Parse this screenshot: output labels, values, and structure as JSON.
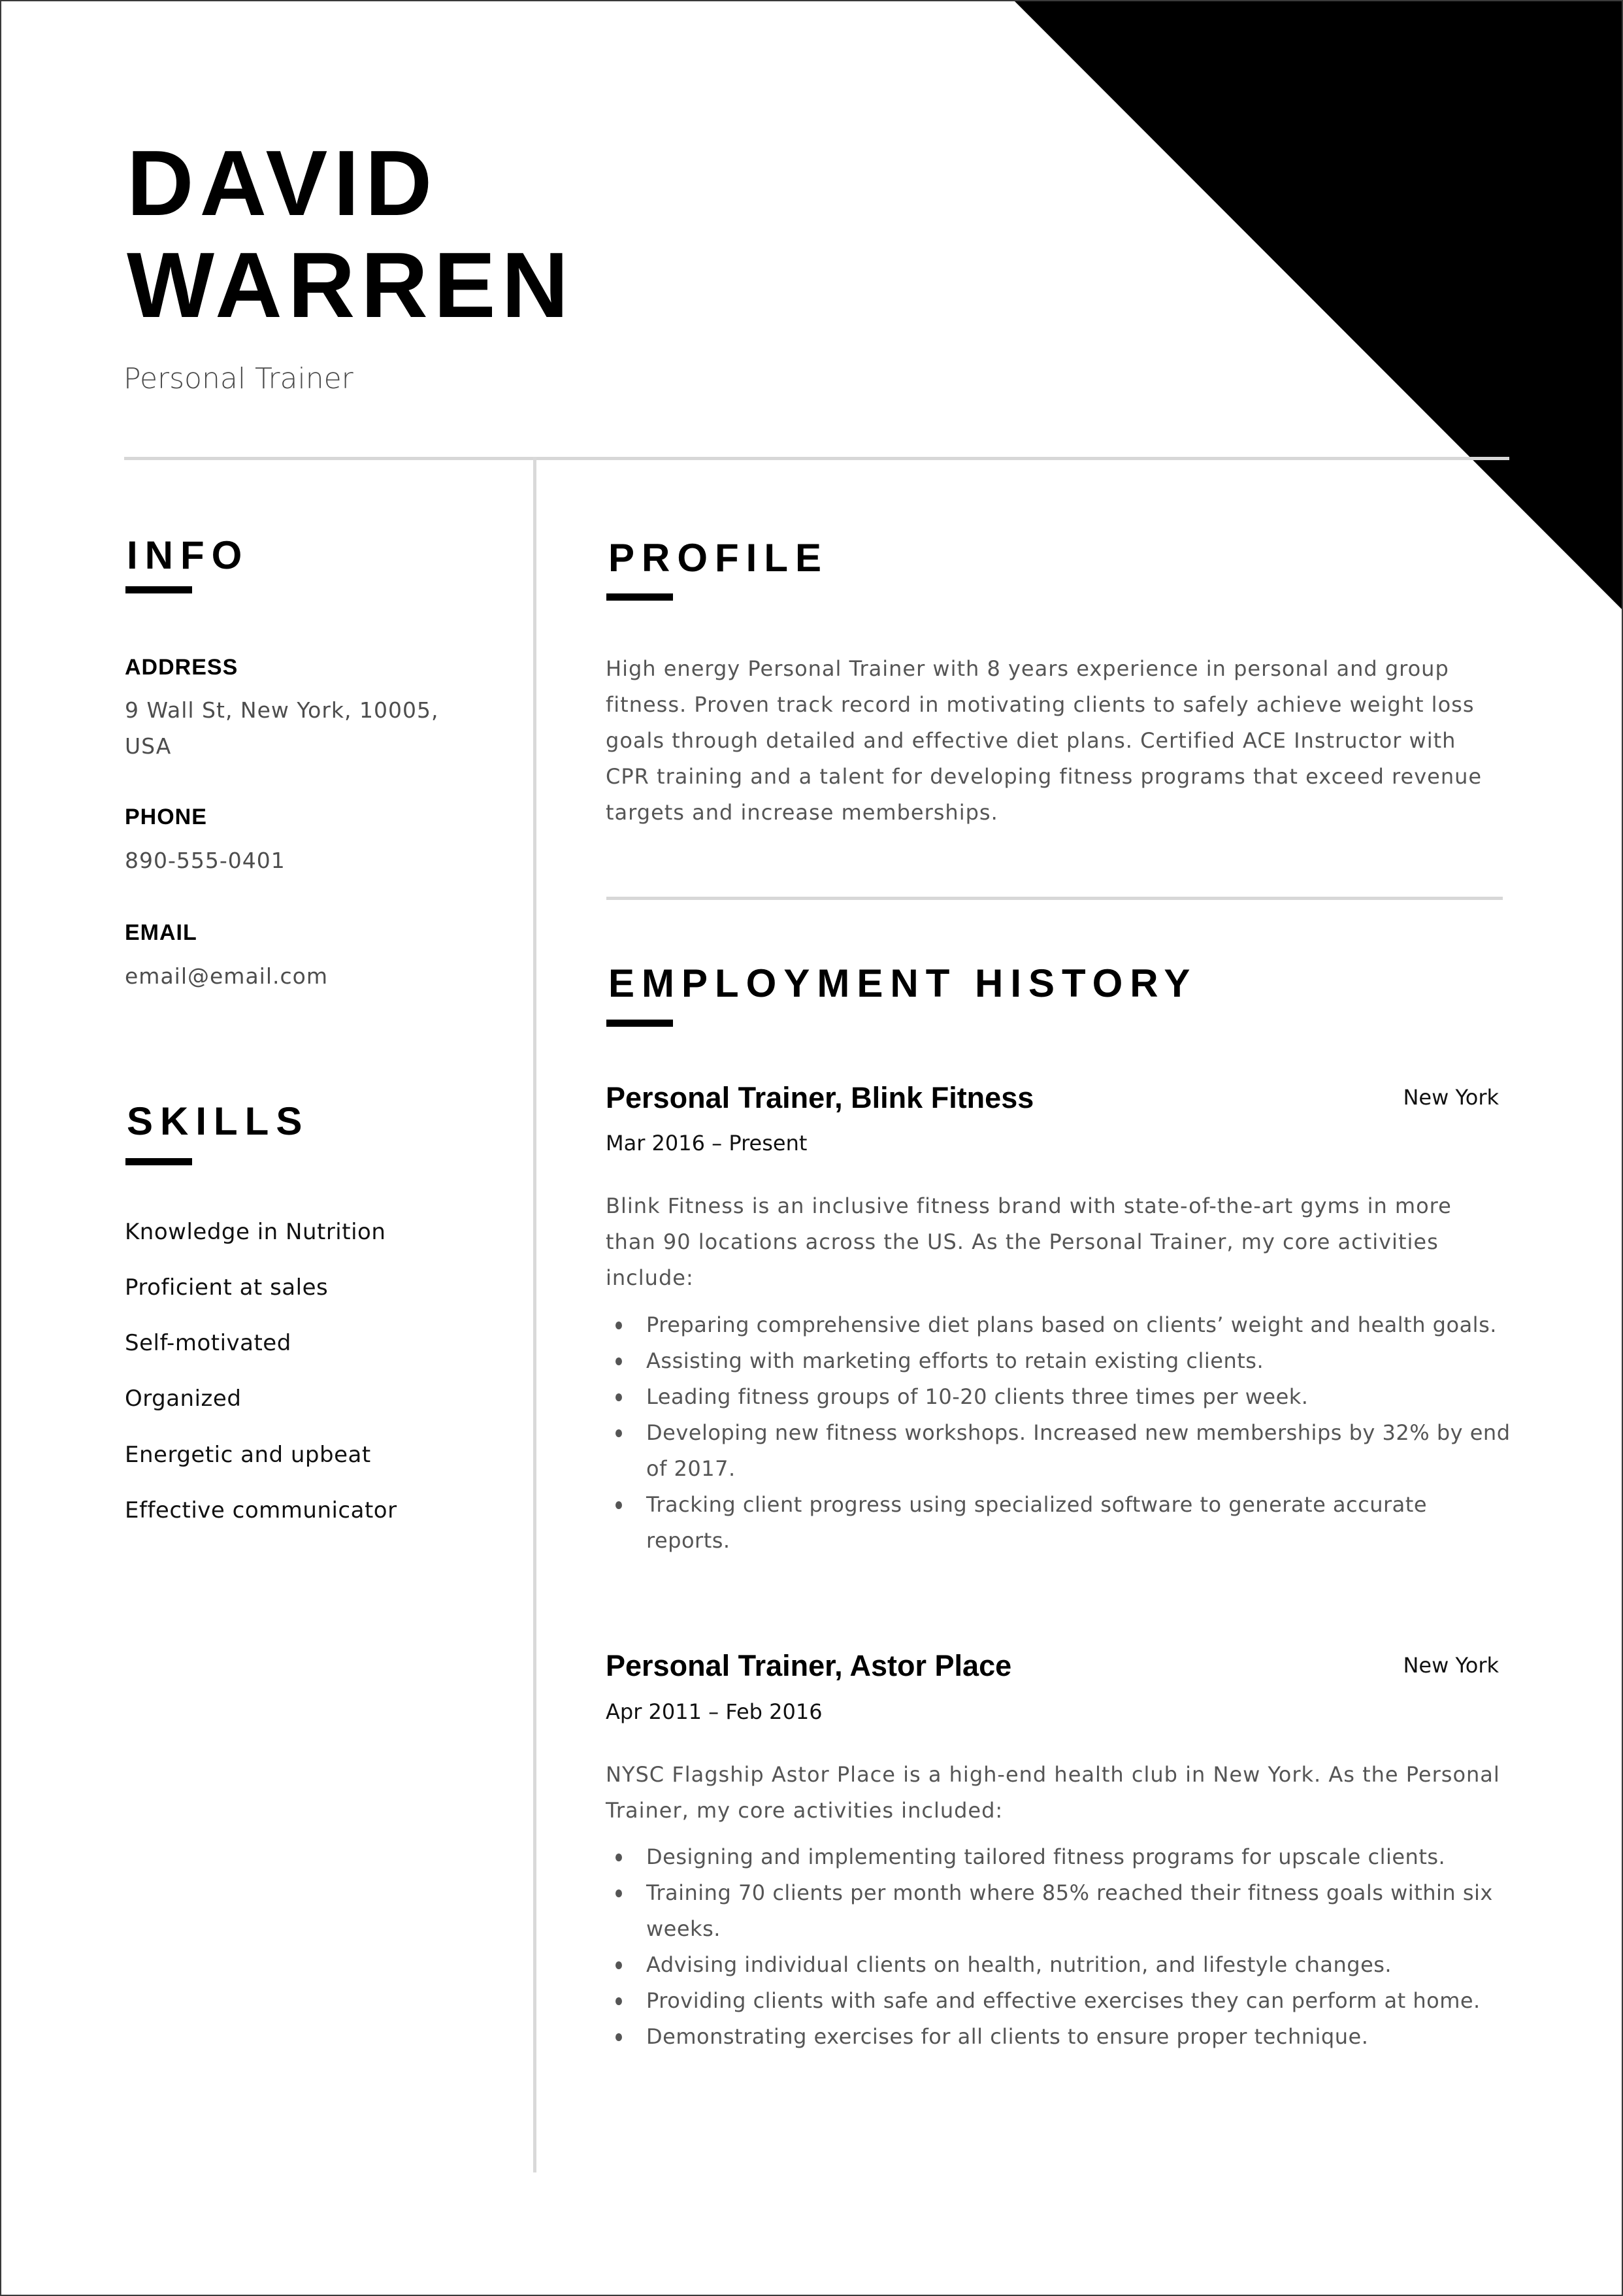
{
  "header": {
    "first_name": "DAVID",
    "last_name": "WARREN",
    "job_title": "Personal Trainer"
  },
  "colors": {
    "text": "#000000",
    "body_text": "#555555",
    "rule": "#d7d7d7",
    "corner_triangle": "#000000"
  },
  "sidebar": {
    "info": {
      "heading": "INFO",
      "address_label": "ADDRESS",
      "address_line1": "9 Wall St, New York, 10005,",
      "address_line2": "USA",
      "phone_label": "PHONE",
      "phone": "890-555-0401",
      "email_label": "EMAIL",
      "email": "email@email.com"
    },
    "skills": {
      "heading": "SKILLS",
      "items": [
        "Knowledge in Nutrition",
        "Proficient at sales",
        "Self-motivated",
        "Organized",
        "Energetic and upbeat",
        "Effective communicator"
      ]
    }
  },
  "main": {
    "profile": {
      "heading": "PROFILE",
      "text": "High energy Personal Trainer with 8 years experience in personal and group fitness. Proven track record in motivating clients to safely achieve weight loss goals through detailed and effective diet plans. Certified ACE Instructor with CPR training and a talent for developing fitness programs that exceed revenue targets and increase memberships."
    },
    "employment": {
      "heading": "EMPLOYMENT HISTORY",
      "jobs": [
        {
          "title": "Personal Trainer, Blink Fitness",
          "location": "New York",
          "dates": "Mar 2016 – Present",
          "description": "Blink Fitness is an inclusive fitness brand with state-of-the-art gyms in more than 90 locations across the US. As the Personal Trainer, my core activities include:",
          "bullets": [
            "Preparing comprehensive diet plans based on clients’ weight and health goals.",
            "Assisting with marketing efforts to retain existing clients.",
            "Leading fitness groups of 10-20 clients three times per week.",
            "Developing new fitness workshops. Increased new memberships by 32% by end of 2017.",
            "Tracking client progress using specialized software to generate accurate reports."
          ]
        },
        {
          "title": "Personal Trainer, Astor Place",
          "location": "New York",
          "dates": "Apr 2011 – Feb 2016",
          "description": "NYSC Flagship Astor Place is a high-end health club in New York. As the Personal Trainer, my core activities included:",
          "bullets": [
            "Designing and implementing tailored fitness programs for upscale clients.",
            "Training 70 clients per month where 85% reached their fitness goals within six weeks.",
            "Advising individual clients on health, nutrition, and lifestyle changes.",
            "Providing clients with safe and effective exercises they can perform at home.",
            "Demonstrating exercises for all clients to ensure proper technique."
          ]
        }
      ]
    }
  }
}
